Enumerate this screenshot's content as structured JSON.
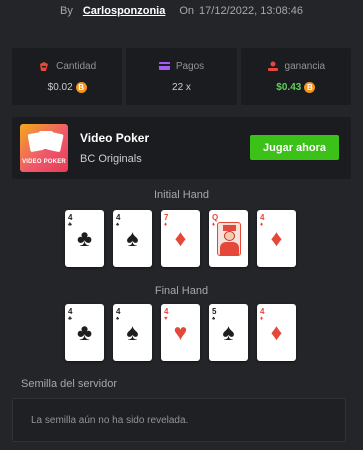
{
  "header": {
    "by_label": "By",
    "username": "Carlosponzonia",
    "on_label": "On",
    "datetime": "17/12/2022, 13:08:46"
  },
  "stats": {
    "amount": {
      "label": "Cantidad",
      "value": "$0.02",
      "coin": "B",
      "icon": "money-bag-icon"
    },
    "payout": {
      "label": "Pagos",
      "value": "22 x",
      "icon": "card-icon"
    },
    "profit": {
      "label": "ganancia",
      "value": "$0.43",
      "coin": "B",
      "icon": "coins-icon"
    }
  },
  "game": {
    "thumb_label": "VIDEO POKER",
    "name": "Video Poker",
    "provider": "BC Originals",
    "play_label": "Jugar ahora"
  },
  "initial_hand": {
    "title": "Initial Hand",
    "cards": [
      {
        "rank": "4",
        "suit": "♣",
        "color": "black"
      },
      {
        "rank": "4",
        "suit": "♠",
        "color": "black"
      },
      {
        "rank": "7",
        "suit": "♦",
        "color": "red"
      },
      {
        "rank": "Q",
        "suit": "♦",
        "color": "red"
      },
      {
        "rank": "4",
        "suit": "♦",
        "color": "red"
      }
    ]
  },
  "final_hand": {
    "title": "Final Hand",
    "cards": [
      {
        "rank": "4",
        "suit": "♣",
        "color": "black"
      },
      {
        "rank": "4",
        "suit": "♠",
        "color": "black"
      },
      {
        "rank": "4",
        "suit": "♥",
        "color": "red"
      },
      {
        "rank": "5",
        "suit": "♠",
        "color": "black"
      },
      {
        "rank": "4",
        "suit": "♦",
        "color": "red"
      }
    ]
  },
  "server_seed": {
    "label": "Semilla del servidor",
    "placeholder": "La semilla aún no ha sido revelada."
  },
  "colors": {
    "background": "#232528",
    "panel": "#1a1c1f",
    "accent_green": "#3bc117",
    "profit_green": "#5fd15a",
    "coin_orange": "#f7931a",
    "card_red": "#e5473b"
  }
}
